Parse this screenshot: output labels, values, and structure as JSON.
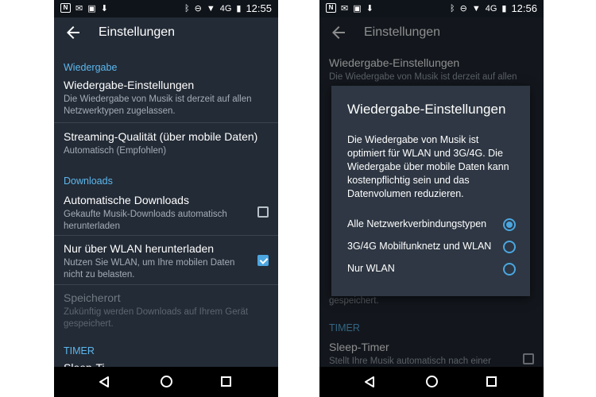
{
  "colors": {
    "background": "#232b36",
    "accent": "#4ba6e0",
    "section_header": "#5db8ee",
    "statusbar": "#0f141a",
    "navbar": "#000000",
    "dialog": "#2e3743"
  },
  "left": {
    "statusbar": {
      "icons_left": [
        "notification-n-icon",
        "gmail-icon",
        "image-icon",
        "download-icon"
      ],
      "icons_right": [
        "bluetooth-icon",
        "do-not-disturb-icon",
        "wifi-icon",
        "signal-4g-icon",
        "battery-icon"
      ],
      "network": "4G",
      "time": "12:55"
    },
    "toolbar": {
      "title": "Einstellungen"
    },
    "sections": {
      "playback": {
        "header": "Wiedergabe",
        "playback_settings": {
          "title": "Wiedergabe-Einstellungen",
          "subtitle": "Die Wiedergabe von Musik ist derzeit auf allen Netzwerktypen zugelassen."
        },
        "streaming_quality": {
          "title": "Streaming-Qualität (über mobile Daten)",
          "subtitle": "Automatisch (Empfohlen)"
        }
      },
      "downloads": {
        "header": "Downloads",
        "auto_downloads": {
          "title": "Automatische Downloads",
          "subtitle": "Gekaufte Musik-Downloads automatisch herunterladen",
          "checked": false
        },
        "wifi_only": {
          "title": "Nur über WLAN herunterladen",
          "subtitle": "Nutzen Sie WLAN, um Ihre mobilen Daten nicht zu belasten.",
          "checked": true
        },
        "storage": {
          "title": "Speicherort",
          "subtitle": "Zukünftig werden Downloads auf Ihrem Gerät gespeichert."
        }
      },
      "timer": {
        "header": "TIMER",
        "sleep_timer_partial": "Sleep-Ti"
      }
    }
  },
  "right": {
    "statusbar": {
      "icons_left": [
        "notification-n-icon",
        "gmail-icon",
        "image-icon",
        "download-icon"
      ],
      "icons_right": [
        "bluetooth-icon",
        "do-not-disturb-icon",
        "wifi-icon",
        "signal-4g-icon",
        "battery-icon"
      ],
      "network": "4G",
      "time": "12:56"
    },
    "toolbar": {
      "title": "Einstellungen"
    },
    "background": {
      "playback_settings_title": "Wiedergabe-Einstellungen",
      "playback_settings_subtitle": "Die Wiedergabe von Musik ist derzeit auf allen",
      "storage_subtitle_tail": "gespeichert.",
      "timer_header": "TIMER",
      "sleep_timer_title": "Sleep-Timer",
      "sleep_timer_subtitle": "Stellt Ihre Musik automatisch nach einer"
    },
    "dialog": {
      "title": "Wiedergabe-Einstellungen",
      "message": "Die Wiedergabe von Musik ist optimiert für WLAN und 3G/4G. Die Wiedergabe über mobile Daten kann kostenpflichtig sein und das Datenvolumen reduzieren.",
      "options": [
        {
          "label": "Alle Netzwerkverbindungstypen",
          "selected": true
        },
        {
          "label": "3G/4G Mobilfunknetz und WLAN",
          "selected": false
        },
        {
          "label": "Nur WLAN",
          "selected": false
        }
      ]
    }
  }
}
